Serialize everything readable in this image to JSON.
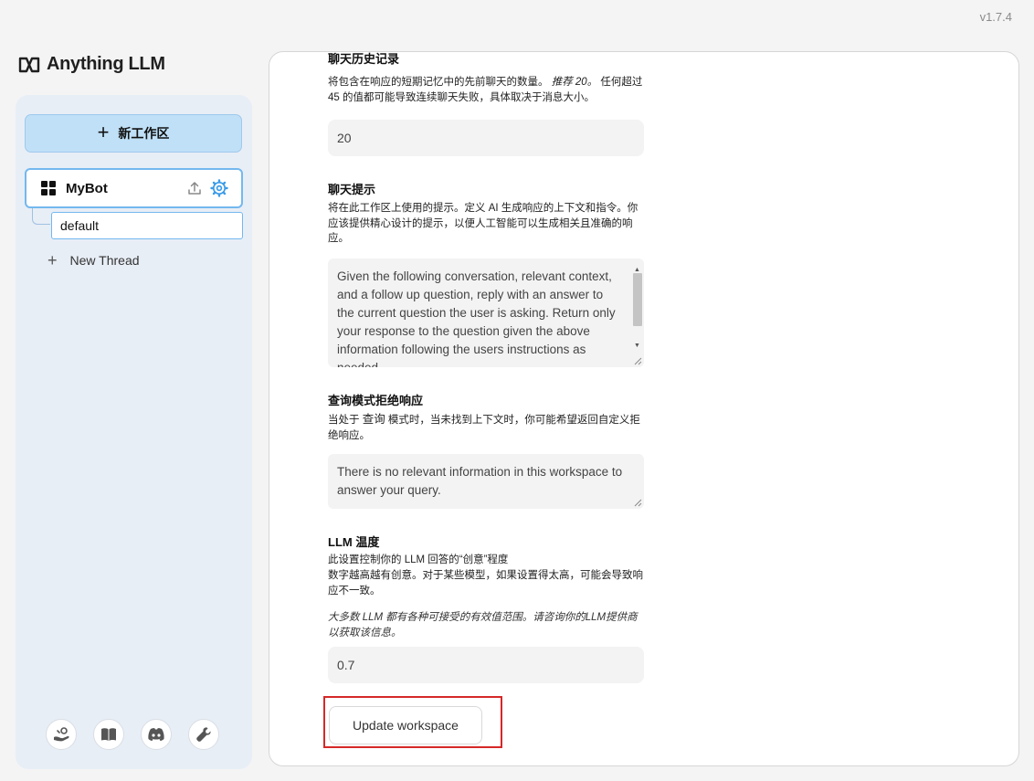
{
  "version": "v1.7.4",
  "brand": {
    "name": "Anything LLM"
  },
  "sidebar": {
    "new_workspace_label": "新工作区",
    "workspace": {
      "name": "MyBot"
    },
    "thread": {
      "name": "default"
    },
    "new_thread_label": "New Thread",
    "footer_icons": [
      "community-hub-icon",
      "docs-book-icon",
      "discord-icon",
      "wrench-settings-icon"
    ]
  },
  "settings": {
    "chat_history": {
      "title": "聊天历史记录",
      "desc_main": "将包含在响应的短期记忆中的先前聊天的数量。",
      "desc_recommend": "推荐 20。",
      "desc_rest": "任何超过 45 的值都可能导致连续聊天失败，具体取决于消息大小。",
      "value": "20"
    },
    "chat_prompt": {
      "title": "聊天提示",
      "desc": "将在此工作区上使用的提示。定义 AI 生成响应的上下文和指令。你应该提供精心设计的提示，以便人工智能可以生成相关且准确的响应。",
      "value": "Given the following conversation, relevant context, and a follow up question, reply with an answer to the current question the user is asking. Return only your response to the question given the above information following the users instructions as needed."
    },
    "query_refusal": {
      "title": "查询模式拒绝响应",
      "desc_prefix": "当处于",
      "desc_mode": "查询",
      "desc_suffix": "模式时，当未找到上下文时，你可能希望返回自定义拒绝响应。",
      "value": "There is no relevant information in this workspace to answer your query."
    },
    "llm_temperature": {
      "title": "LLM 温度",
      "desc_line1": "此设置控制你的 LLM 回答的“创意”程度",
      "desc_line2": "数字越高越有创意。对于某些模型，如果设置得太高，可能会导致响应不一致。",
      "note": "大多数 LLM 都有各种可接受的有效值范围。请咨询你的LLM提供商以获取该信息。",
      "value": "0.7"
    },
    "update_button_label": "Update workspace"
  },
  "colors": {
    "accent_blue": "#74b8ef",
    "new_workspace_bg": "#bfe0f7",
    "highlight_red": "#d62828"
  }
}
